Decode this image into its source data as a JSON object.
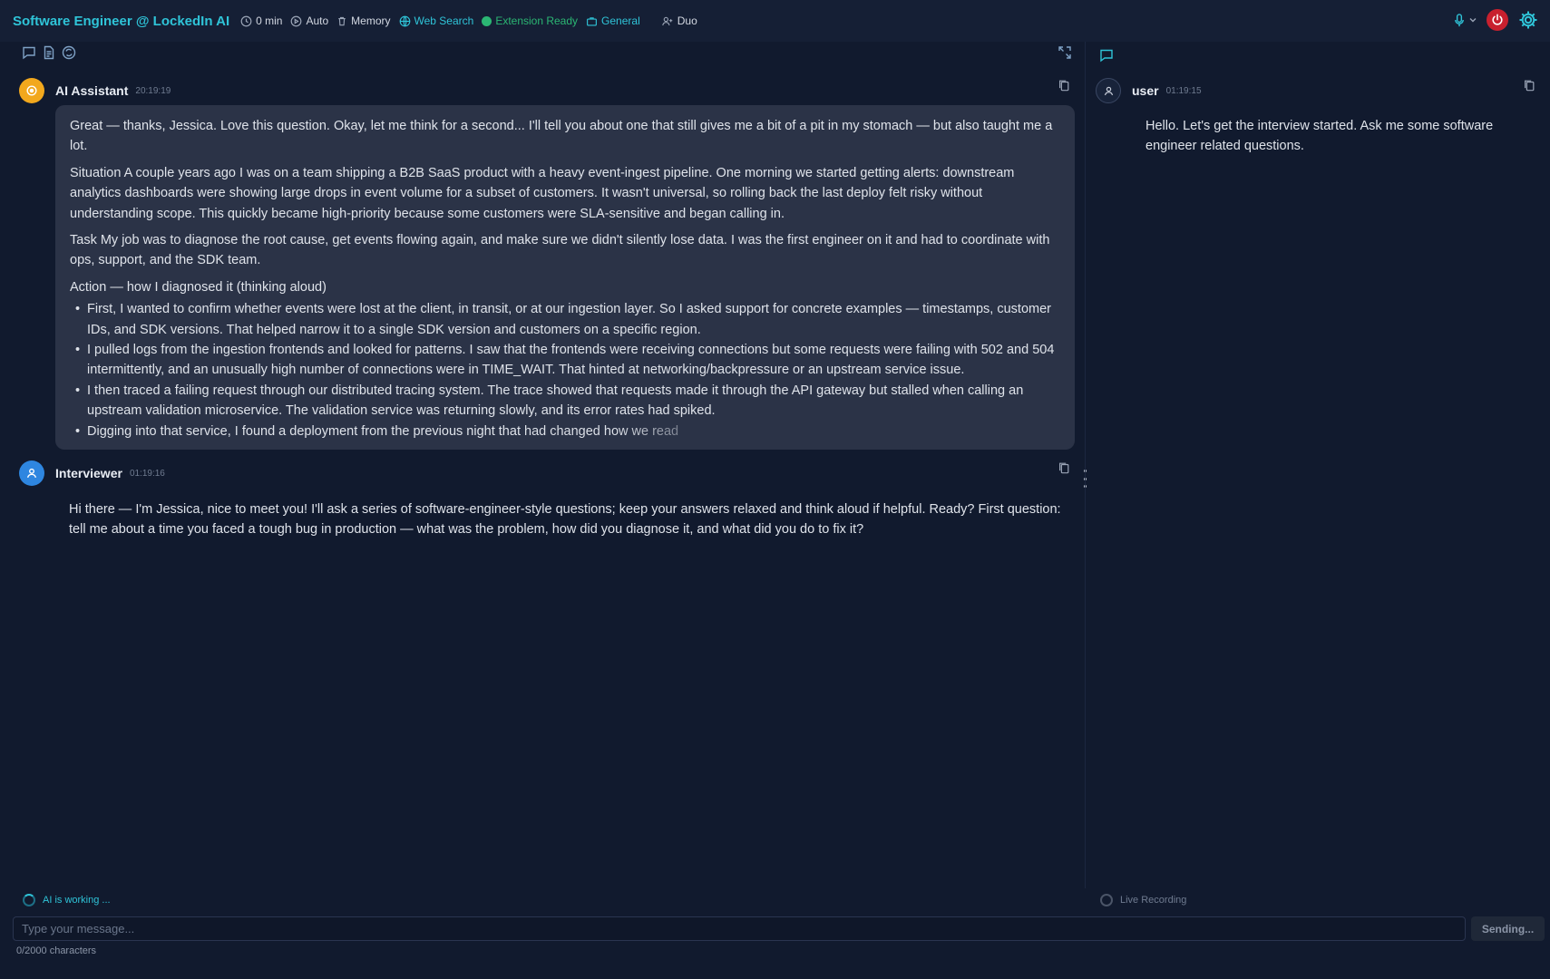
{
  "header": {
    "title": "Software Engineer @ LockedIn AI",
    "timer": "0 min",
    "mode": "Auto",
    "memory": "Memory",
    "web_search": "Web Search",
    "extension_status": "Extension Ready",
    "context": "General",
    "session_type": "Duo"
  },
  "left_pane": {
    "ai_message": {
      "sender": "AI Assistant",
      "time": "20:19:19",
      "paragraphs": [
        "Great — thanks, Jessica. Love this question. Okay, let me think for a second... I'll tell you about one that still gives me a bit of a pit in my stomach — but also taught me a lot.",
        "Situation A couple years ago I was on a team shipping a B2B SaaS product with a heavy event-ingest pipeline. One morning we started getting alerts: downstream analytics dashboards were showing large drops in event volume for a subset of customers. It wasn't universal, so rolling back the last deploy felt risky without understanding scope. This quickly became high-priority because some customers were SLA-sensitive and began calling in.",
        "Task My job was to diagnose the root cause, get events flowing again, and make sure we didn't silently lose data. I was the first engineer on it and had to coordinate with ops, support, and the SDK team.",
        "Action — how I diagnosed it (thinking aloud)"
      ],
      "bullets": [
        "First, I wanted to confirm whether events were lost at the client, in transit, or at our ingestion layer. So I asked support for concrete examples — timestamps, customer IDs, and SDK versions. That helped narrow it to a single SDK version and customers on a specific region.",
        "I pulled logs from the ingestion frontends and looked for patterns. I saw that the frontends were receiving connections but some requests were failing with 502 and 504 intermittently, and an unusually high number of connections were in TIME_WAIT. That hinted at networking/backpressure or an upstream service issue.",
        "I then traced a failing request through our distributed tracing system. The trace showed that requests made it through the API gateway but stalled when calling an upstream validation microservice. The validation service was returning slowly, and its error rates had spiked."
      ],
      "streaming_bullet_start": "Digging into that service, I found a deployment from the previous night that ",
      "streaming_bullet_fade": "had changed how we read"
    },
    "interviewer_message": {
      "sender": "Interviewer",
      "time": "01:19:16",
      "text": "Hi there — I'm Jessica, nice to meet you! I'll ask a series of software-engineer-style questions; keep your answers relaxed and think aloud if helpful. Ready? First question: tell me about a time you faced a tough bug in production — what was the problem, how did you diagnose it, and what did you do to fix it?"
    },
    "status": "AI is working ..."
  },
  "right_pane": {
    "user_message": {
      "sender": "user",
      "time": "01:19:15",
      "text": "Hello. Let's get the interview started. Ask me some software engineer related questions."
    },
    "recording_status": "Live Recording"
  },
  "composer": {
    "placeholder": "Type your message...",
    "send_label": "Sending...",
    "char_count": "0/2000 characters"
  },
  "colors": {
    "accent": "#2fc4d8",
    "success": "#2bb673",
    "danger": "#c8202e",
    "background": "#111a2e",
    "bubble": "#2b3347"
  },
  "icons": [
    "clock-icon",
    "play-circle-icon",
    "trash-icon",
    "globe-icon",
    "briefcase-icon",
    "user-plus-icon",
    "mic-icon",
    "chevron-down-icon",
    "power-icon",
    "gear-icon",
    "chat-icon",
    "document-icon",
    "sync-icon",
    "expand-icon",
    "copy-icon",
    "user-icon",
    "kebab-icon"
  ]
}
